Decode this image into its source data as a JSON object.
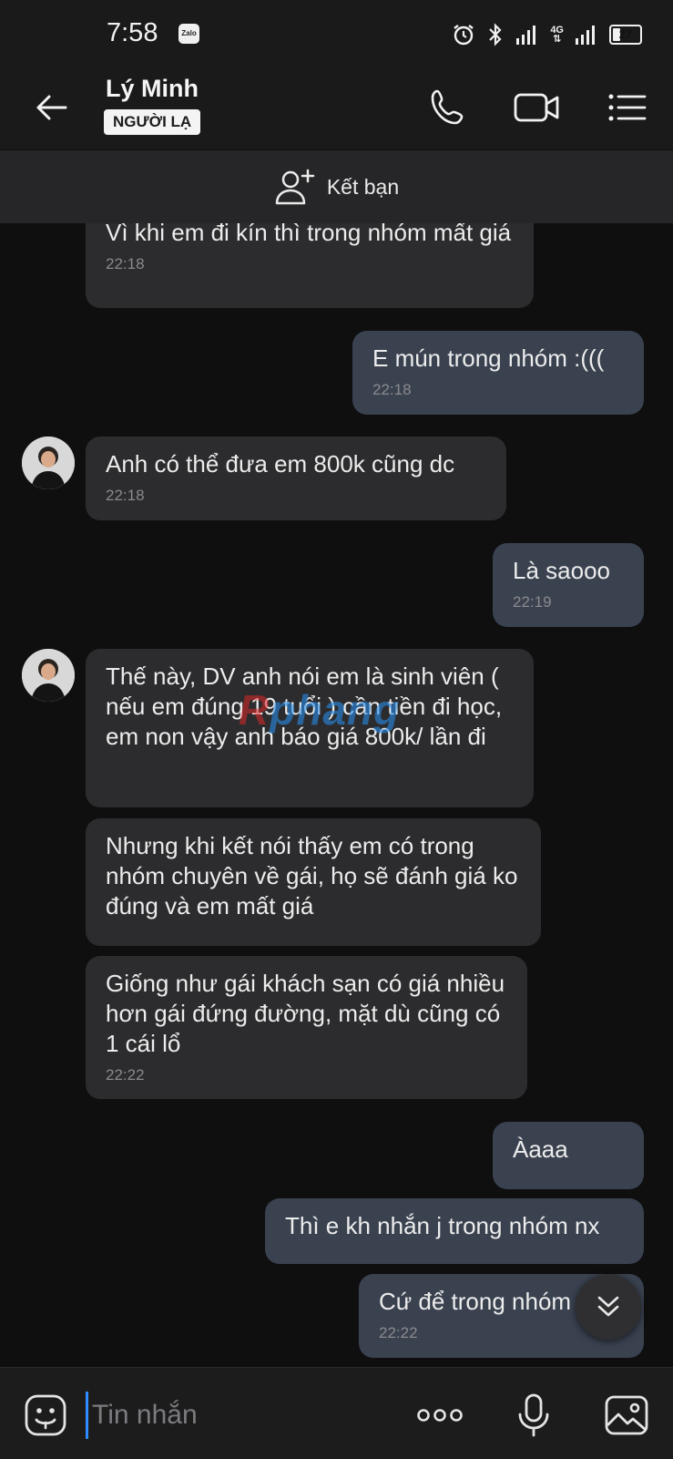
{
  "status_bar": {
    "time": "7:58",
    "app_badge": "Zalo",
    "network": "4G",
    "battery": 27,
    "icons": [
      "zalo-icon",
      "alarm-icon",
      "bluetooth-icon",
      "signal-icon",
      "4g-icon",
      "signal-icon",
      "battery-icon"
    ]
  },
  "header": {
    "name": "Lý Minh",
    "badge": "NGƯỜI LẠ",
    "icons": [
      "back-arrow-icon",
      "phone-icon",
      "video-camera-icon",
      "menu-list-icon"
    ]
  },
  "add_friend": {
    "label": "Kết bạn",
    "icon": "add-person-icon"
  },
  "messages": [
    {
      "side": "in",
      "text": "Vì khi em đi kín thì trong nhóm mất giá",
      "time": "22:18"
    },
    {
      "side": "out",
      "text": "E mún trong nhóm :(((",
      "time": "22:18"
    },
    {
      "side": "in",
      "text": "Anh có thể đưa em 800k cũng dc",
      "time": "22:18"
    },
    {
      "side": "out",
      "text": "Là saooo",
      "time": "22:19"
    },
    {
      "side": "in",
      "text": "Thế này, DV anh nói em là sinh viên ( nếu em đúng 19 tuổi ) cần tiền đi học, em non vậy anh báo giá 800k/ lần đi",
      "time": ""
    },
    {
      "side": "in",
      "text": "Nhưng khi kết nói thấy em có trong nhóm chuyên về gái, họ sẽ đánh giá ko đúng và em mất giá",
      "time": ""
    },
    {
      "side": "in",
      "text": "Giống như gái khách sạn có giá nhiều hơn gái đứng đường, mặt dù cũng có 1 cái lổ",
      "time": "22:22"
    },
    {
      "side": "out",
      "text": "Àaaa",
      "time": ""
    },
    {
      "side": "out",
      "text": "Thì e kh nhắn j trong nhóm nx",
      "time": ""
    },
    {
      "side": "out",
      "text": "Cứ để trong nhóm",
      "time": "22:22"
    }
  ],
  "watermark": {
    "part1": "R",
    "part2": "phang"
  },
  "input_bar": {
    "placeholder": "Tin nhắn",
    "icons": [
      "sticker-icon",
      "more-dots-icon",
      "microphone-icon",
      "image-icon"
    ]
  },
  "colors": {
    "background": "#0f0f10",
    "incoming_bubble": "#2c2c2e",
    "outgoing_bubble": "#3a4250",
    "cursor": "#2d8cff"
  }
}
